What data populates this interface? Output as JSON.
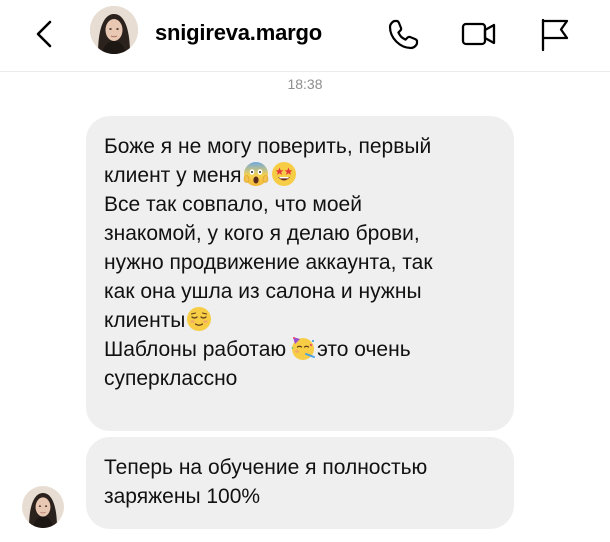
{
  "header": {
    "username": "snigireva.margo",
    "icons": {
      "back": "chevron-left-icon",
      "call": "phone-icon",
      "video": "video-camera-icon",
      "report": "flag-icon"
    }
  },
  "chat": {
    "timestamp": "18:38",
    "messages": [
      {
        "lines": [
          {
            "text": "Боже я не могу поверить, первый"
          },
          {
            "text": "клиент у меня",
            "emojis": [
              "screaming-face-emoji",
              "star-struck-emoji"
            ]
          },
          {
            "text": "Все так совпало, что моей"
          },
          {
            "text": "знакомой, у кого я делаю брови,"
          },
          {
            "text": "нужно продвижение аккаунта, так"
          },
          {
            "text": "как она ушла из салона и нужны"
          },
          {
            "text": "клиенты",
            "emojis": [
              "relieved-face-emoji"
            ]
          },
          {
            "text_before": "Шаблоны работаю",
            "emojis": [
              "partying-face-emoji"
            ],
            "text_after": "это очень"
          },
          {
            "text": "суперклассно"
          }
        ]
      },
      {
        "lines": [
          {
            "text": "Теперь на обучение я полностью"
          },
          {
            "text": "заряжены 100%"
          }
        ]
      }
    ]
  },
  "colors": {
    "bubble_bg": "#efefef",
    "timestamp": "#8e8e8e",
    "divider": "#ececec"
  }
}
